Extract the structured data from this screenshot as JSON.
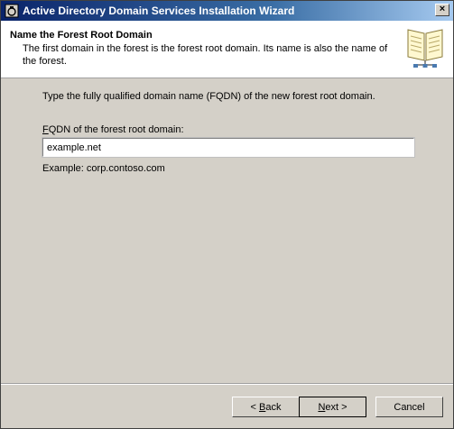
{
  "window": {
    "title": "Active Directory Domain Services Installation Wizard",
    "close_glyph": "×",
    "titlebar_color": "#0a246a"
  },
  "header": {
    "title": "Name the Forest Root Domain",
    "description": "The first domain in the forest is the forest root domain. Its name is also the name of the forest.",
    "icon": "book-icon"
  },
  "content": {
    "instruction": "Type the fully qualified domain name (FQDN) of the new forest root domain.",
    "field_label_accel": "F",
    "field_label_rest": "QDN of the forest root domain:",
    "fqdn_value": "example.net",
    "example": "Example: corp.contoso.com"
  },
  "buttons": {
    "back_prefix": "< ",
    "back_accel": "B",
    "back_rest": "ack",
    "next_accel": "N",
    "next_rest": "ext >",
    "cancel": "Cancel"
  }
}
